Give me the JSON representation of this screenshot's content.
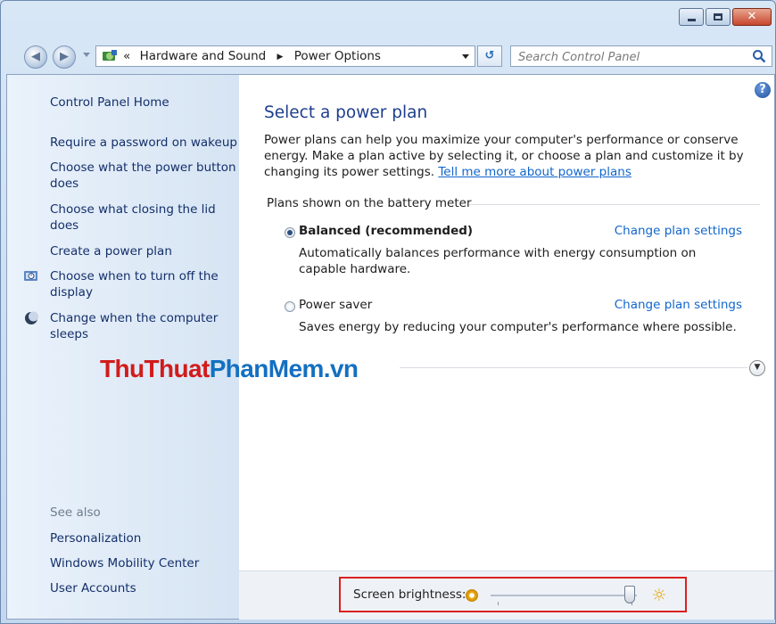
{
  "address": {
    "overflow_chevrons": "«",
    "path": [
      "Hardware and Sound",
      "Power Options"
    ]
  },
  "search": {
    "placeholder": "Search Control Panel"
  },
  "sidebar": {
    "home": "Control Panel Home",
    "links": [
      "Require a password on wakeup",
      "Choose what the power button does",
      "Choose what closing the lid does",
      "Create a power plan",
      "Choose when to turn off the display",
      "Change when the computer sleeps"
    ],
    "see_also_label": "See also",
    "see_also": [
      "Personalization",
      "Windows Mobility Center",
      "User Accounts"
    ]
  },
  "main": {
    "heading": "Select a power plan",
    "description": "Power plans can help you maximize your computer's performance or conserve energy. Make a plan active by selecting it, or choose a plan and customize it by changing its power settings.",
    "learn_more": "Tell me more about power plans",
    "group_label": "Plans shown on the battery meter",
    "plans": [
      {
        "name": "Balanced (recommended)",
        "selected": true,
        "description": "Automatically balances performance with energy consumption on capable hardware.",
        "change": "Change plan settings"
      },
      {
        "name": "Power saver",
        "selected": false,
        "description": "Saves energy by reducing your computer's performance where possible.",
        "change": "Change plan settings"
      }
    ]
  },
  "watermark": {
    "part1": "ThuThuat",
    "part2": "PhanMem",
    "part3": ".vn"
  },
  "footer": {
    "brightness_label": "Screen brightness:",
    "brightness_level": 0.95
  },
  "colors": {
    "link": "#1166cc",
    "sidebar_link": "#142f6a",
    "heading": "#1e3e8e",
    "highlight_box": "#dc2020"
  },
  "icons": [
    "back-icon",
    "forward-icon",
    "control-panel-icon",
    "refresh-icon",
    "search-icon",
    "help-icon",
    "display-clock-icon",
    "moon-sleep-icon",
    "dim-brightness-icon",
    "bright-sun-icon",
    "expand-chevron-icon"
  ]
}
